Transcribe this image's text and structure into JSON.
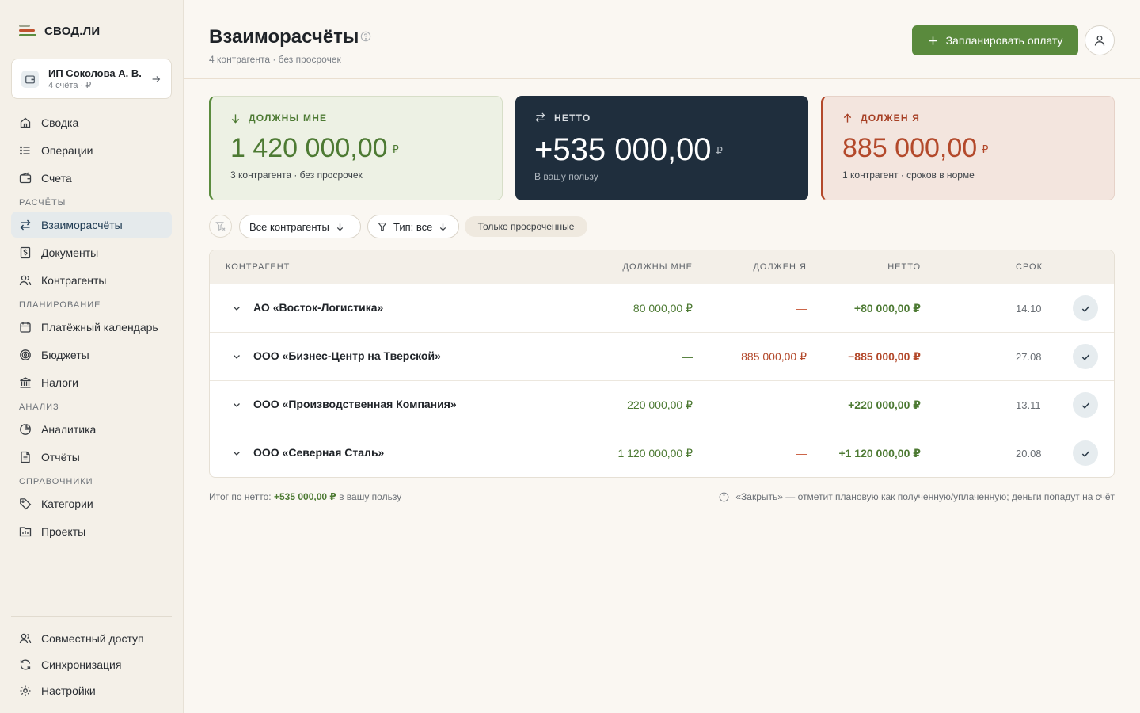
{
  "brand": {
    "name": "СВОД.ЛИ"
  },
  "account": {
    "name": "ИП Соколова А. В.",
    "sub": "4 счёта · ₽"
  },
  "nav": {
    "main": [
      {
        "label": "Сводка",
        "icon": "home-icon"
      },
      {
        "label": "Операции",
        "icon": "list-icon"
      },
      {
        "label": "Счета",
        "icon": "wallet-icon"
      }
    ],
    "sections": [
      {
        "title": "РАСЧЁТЫ",
        "items": [
          {
            "label": "Взаиморасчёты",
            "icon": "swap-icon",
            "active": true
          },
          {
            "label": "Документы",
            "icon": "document-icon"
          },
          {
            "label": "Контрагенты",
            "icon": "users-icon"
          }
        ]
      },
      {
        "title": "ПЛАНИРОВАНИЕ",
        "items": [
          {
            "label": "Платёжный календарь",
            "icon": "calendar-icon"
          },
          {
            "label": "Бюджеты",
            "icon": "target-icon"
          },
          {
            "label": "Налоги",
            "icon": "bank-icon"
          }
        ]
      },
      {
        "title": "АНАЛИЗ",
        "items": [
          {
            "label": "Аналитика",
            "icon": "pie-chart-icon"
          },
          {
            "label": "Отчёты",
            "icon": "report-icon"
          }
        ]
      },
      {
        "title": "СПРАВОЧНИКИ",
        "items": [
          {
            "label": "Категории",
            "icon": "tag-icon"
          },
          {
            "label": "Проекты",
            "icon": "folder-icon"
          }
        ]
      }
    ],
    "bottom": [
      {
        "label": "Совместный доступ",
        "icon": "share-users-icon"
      },
      {
        "label": "Синхронизация",
        "icon": "sync-icon"
      },
      {
        "label": "Настройки",
        "icon": "gear-icon"
      }
    ]
  },
  "header": {
    "title": "Взаиморасчёты",
    "subtitle": "4 контрагента · без просрочек",
    "plan_button": "Запланировать оплату"
  },
  "cards": {
    "owed_to_me": {
      "label": "ДОЛЖНЫ МНЕ",
      "amount": "1 420 000,00",
      "currency": "₽",
      "note": "3 контрагента · без просрочек",
      "color": "#5B8C3E"
    },
    "net": {
      "label": "НЕТТО",
      "amount": "+535 000,00",
      "currency": "₽",
      "note": "В вашу пользу",
      "color": "#1F2E3D"
    },
    "i_owe": {
      "label": "ДОЛЖЕН Я",
      "amount": "885 000,00",
      "currency": "₽",
      "note": "1 контрагент · сроков в норме",
      "color": "#B3492B"
    }
  },
  "filters": {
    "counterparties": "Все контрагенты",
    "type": "Тип: все",
    "overdue_only": "Только просроченные"
  },
  "table": {
    "headers": {
      "name": "КОНТРАГЕНТ",
      "owed": "ДОЛЖНЫ МНЕ",
      "owe": "ДОЛЖЕН Я",
      "net": "НЕТТО",
      "due": "СРОК"
    },
    "rows": [
      {
        "name": "АО «Восток-Логистика»",
        "owed": "80 000,00 ₽",
        "owe": "—",
        "net": "+80 000,00 ₽",
        "net_sign": "pos",
        "due": "14.10"
      },
      {
        "name": "ООО «Бизнес-Центр на Тверской»",
        "owed": "—",
        "owe": "885 000,00 ₽",
        "net": "−885 000,00 ₽",
        "net_sign": "neg",
        "due": "27.08"
      },
      {
        "name": "ООО «Производственная Компания»",
        "owed": "220 000,00 ₽",
        "owe": "—",
        "net": "+220 000,00 ₽",
        "net_sign": "pos",
        "due": "13.11"
      },
      {
        "name": "ООО «Северная Сталь»",
        "owed": "1 120 000,00 ₽",
        "owe": "—",
        "net": "+1 120 000,00 ₽",
        "net_sign": "pos",
        "due": "20.08"
      }
    ]
  },
  "footer": {
    "net_prefix": "Итог по нетто:",
    "net_value": "+535 000,00 ₽",
    "net_suffix": "в вашу пользу",
    "hint": "«Закрыть» — отметит плановую как полученную/уплаченную; деньги попадут на счёт"
  }
}
